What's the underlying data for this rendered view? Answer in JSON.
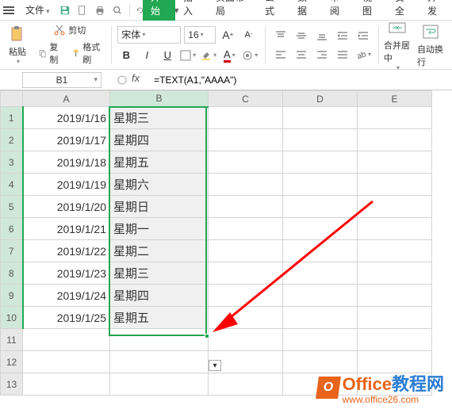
{
  "menubar": {
    "file": "文件",
    "qat": [
      "save",
      "new",
      "print",
      "preview",
      "undo",
      "redo"
    ]
  },
  "tabs": [
    "开始",
    "插入",
    "页面布局",
    "公式",
    "数据",
    "审阅",
    "视图",
    "安全",
    "开发"
  ],
  "active_tab": 0,
  "ribbon": {
    "paste": "粘贴",
    "cut": "剪切",
    "copy": "复制",
    "format_painter": "格式刷",
    "font_name": "宋体",
    "font_size": "16",
    "merge_center": "合并居中",
    "wrap_text": "自动换行"
  },
  "formula_bar": {
    "namebox": "B1",
    "formula": "=TEXT(A1,\"AAAA\")"
  },
  "columns": [
    "A",
    "B",
    "C",
    "D",
    "E"
  ],
  "rows": [
    {
      "n": 1,
      "a": "2019/1/16",
      "b": "星期三"
    },
    {
      "n": 2,
      "a": "2019/1/17",
      "b": "星期四"
    },
    {
      "n": 3,
      "a": "2019/1/18",
      "b": "星期五"
    },
    {
      "n": 4,
      "a": "2019/1/19",
      "b": "星期六"
    },
    {
      "n": 5,
      "a": "2019/1/20",
      "b": "星期日"
    },
    {
      "n": 6,
      "a": "2019/1/21",
      "b": "星期一"
    },
    {
      "n": 7,
      "a": "2019/1/22",
      "b": "星期二"
    },
    {
      "n": 8,
      "a": "2019/1/23",
      "b": "星期三"
    },
    {
      "n": 9,
      "a": "2019/1/24",
      "b": "星期四"
    },
    {
      "n": 10,
      "a": "2019/1/25",
      "b": "星期五"
    },
    {
      "n": 11,
      "a": "",
      "b": ""
    },
    {
      "n": 12,
      "a": "",
      "b": ""
    },
    {
      "n": 13,
      "a": "",
      "b": ""
    }
  ],
  "watermark": {
    "brand1": "Office",
    "brand2": "教程网",
    "url": "www.office26.com"
  }
}
